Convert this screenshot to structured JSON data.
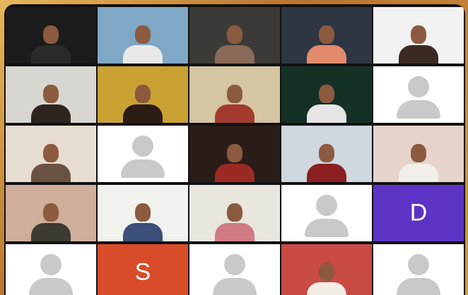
{
  "gallery": {
    "tiles": [
      {
        "kind": "video",
        "bg": "#1b1b1b",
        "accent": "#2a2a2a"
      },
      {
        "kind": "video",
        "bg": "#7fa7c6",
        "accent": "#e9e9e9"
      },
      {
        "kind": "video",
        "bg": "#3b3a36",
        "accent": "#8a6a58"
      },
      {
        "kind": "video",
        "bg": "#2d3642",
        "accent": "#e38b6d"
      },
      {
        "kind": "video",
        "bg": "#f2f2f2",
        "accent": "#3a2a22"
      },
      {
        "kind": "video",
        "bg": "#d8d6d0",
        "accent": "#2b241f"
      },
      {
        "kind": "video",
        "bg": "#c9a233",
        "accent": "#2b1c14"
      },
      {
        "kind": "video",
        "bg": "#d5c5a2",
        "accent": "#a23b2e"
      },
      {
        "kind": "video",
        "bg": "#153125",
        "accent": "#e6e6e6"
      },
      {
        "kind": "avatar",
        "bg": "#ffffff"
      },
      {
        "kind": "video",
        "bg": "#e6ddd0",
        "accent": "#6b5141"
      },
      {
        "kind": "avatar",
        "bg": "#ffffff"
      },
      {
        "kind": "video",
        "bg": "#2a1c18",
        "accent": "#9b2a23"
      },
      {
        "kind": "video",
        "bg": "#cfd7df",
        "accent": "#8b1f22"
      },
      {
        "kind": "video",
        "bg": "#e7d3cb",
        "accent": "#f1efea"
      },
      {
        "kind": "video",
        "bg": "#cfae9c",
        "accent": "#3d3a33"
      },
      {
        "kind": "video",
        "bg": "#f1f1ee",
        "accent": "#3b4f7a"
      },
      {
        "kind": "video",
        "bg": "#e9e6df",
        "accent": "#d07a83"
      },
      {
        "kind": "avatar",
        "bg": "#ffffff"
      },
      {
        "kind": "initial",
        "bg": "#5d33c5",
        "text": "D"
      },
      {
        "kind": "avatar",
        "bg": "#ffffff"
      },
      {
        "kind": "initial",
        "bg": "#d84c2a",
        "text": "S"
      },
      {
        "kind": "avatar",
        "bg": "#ffffff"
      },
      {
        "kind": "video",
        "bg": "#c94b43",
        "accent": "#f2eee6"
      },
      {
        "kind": "avatar",
        "bg": "#ffffff"
      }
    ]
  }
}
